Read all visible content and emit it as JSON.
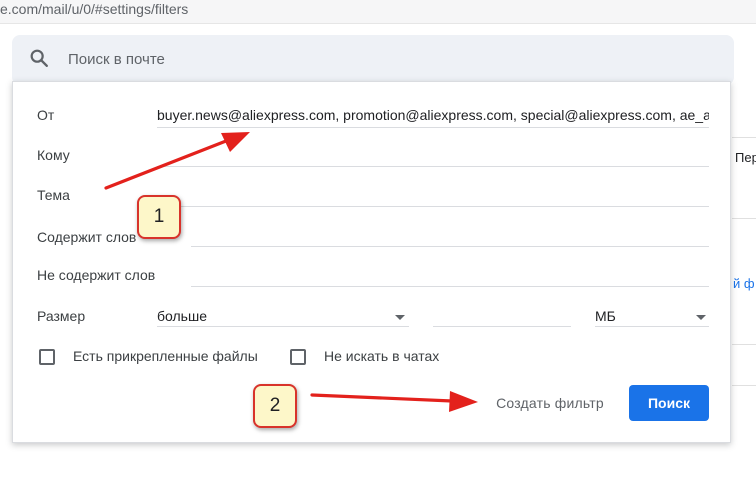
{
  "browser": {
    "url": "e.com/mail/u/0/#settings/filters"
  },
  "search": {
    "placeholder": "Поиск в почте"
  },
  "background": {
    "column_header": "Пер",
    "link_fragment": "й ф"
  },
  "filter_form": {
    "from_label": "От",
    "from_value": "buyer.news@aliexpress.com, promotion@aliexpress.com, special@aliexpress.com, ae_ac",
    "to_label": "Кому",
    "to_value": "",
    "subject_label": "Тема",
    "subject_value": "",
    "has_words_label": "Содержит слов",
    "has_words_value": "",
    "no_words_label": "Не содержит слов",
    "no_words_value": "",
    "size_label": "Размер",
    "size_operator": "больше",
    "size_value": "",
    "size_unit": "МБ",
    "has_attachment_label": "Есть прикрепленные файлы",
    "has_attachment_checked": false,
    "no_chats_label": "Не искать в чатах",
    "no_chats_checked": false,
    "create_filter_label": "Создать фильтр",
    "search_label": "Поиск"
  },
  "annotations": {
    "badge_1": "1",
    "badge_2": "2",
    "arrow_color": "#e3211c",
    "badge_fill": "#fdf7c9"
  },
  "colors": {
    "primary_button": "#1a73e8",
    "search_bar_bg": "#eef1f6"
  },
  "icons": {
    "search": "search-icon",
    "dropdown": "caret-down-icon"
  }
}
